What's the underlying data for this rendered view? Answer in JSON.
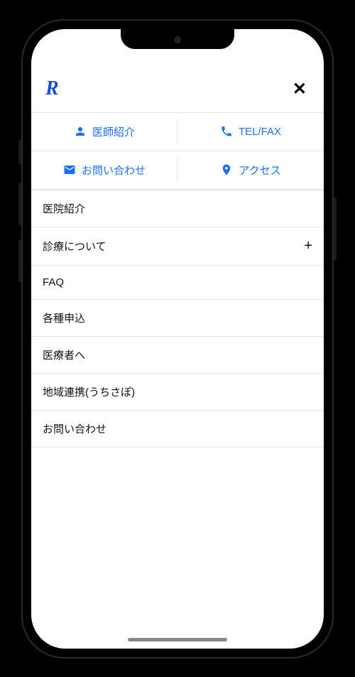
{
  "logo": "R",
  "close": "✕",
  "quick_links": [
    {
      "icon": "person",
      "label": "医師紹介"
    },
    {
      "icon": "phone",
      "label": "TEL/FAX"
    },
    {
      "icon": "mail",
      "label": "お問い合わせ"
    },
    {
      "icon": "pin",
      "label": "アクセス"
    }
  ],
  "menu": [
    {
      "label": "医院紹介",
      "expandable": false
    },
    {
      "label": "診療について",
      "expandable": true
    },
    {
      "label": "FAQ",
      "expandable": false
    },
    {
      "label": "各種申込",
      "expandable": false
    },
    {
      "label": "医療者へ",
      "expandable": false
    },
    {
      "label": "地域連携(うちさぽ)",
      "expandable": false
    },
    {
      "label": "お問い合わせ",
      "expandable": false
    }
  ],
  "expand_symbol": "+"
}
